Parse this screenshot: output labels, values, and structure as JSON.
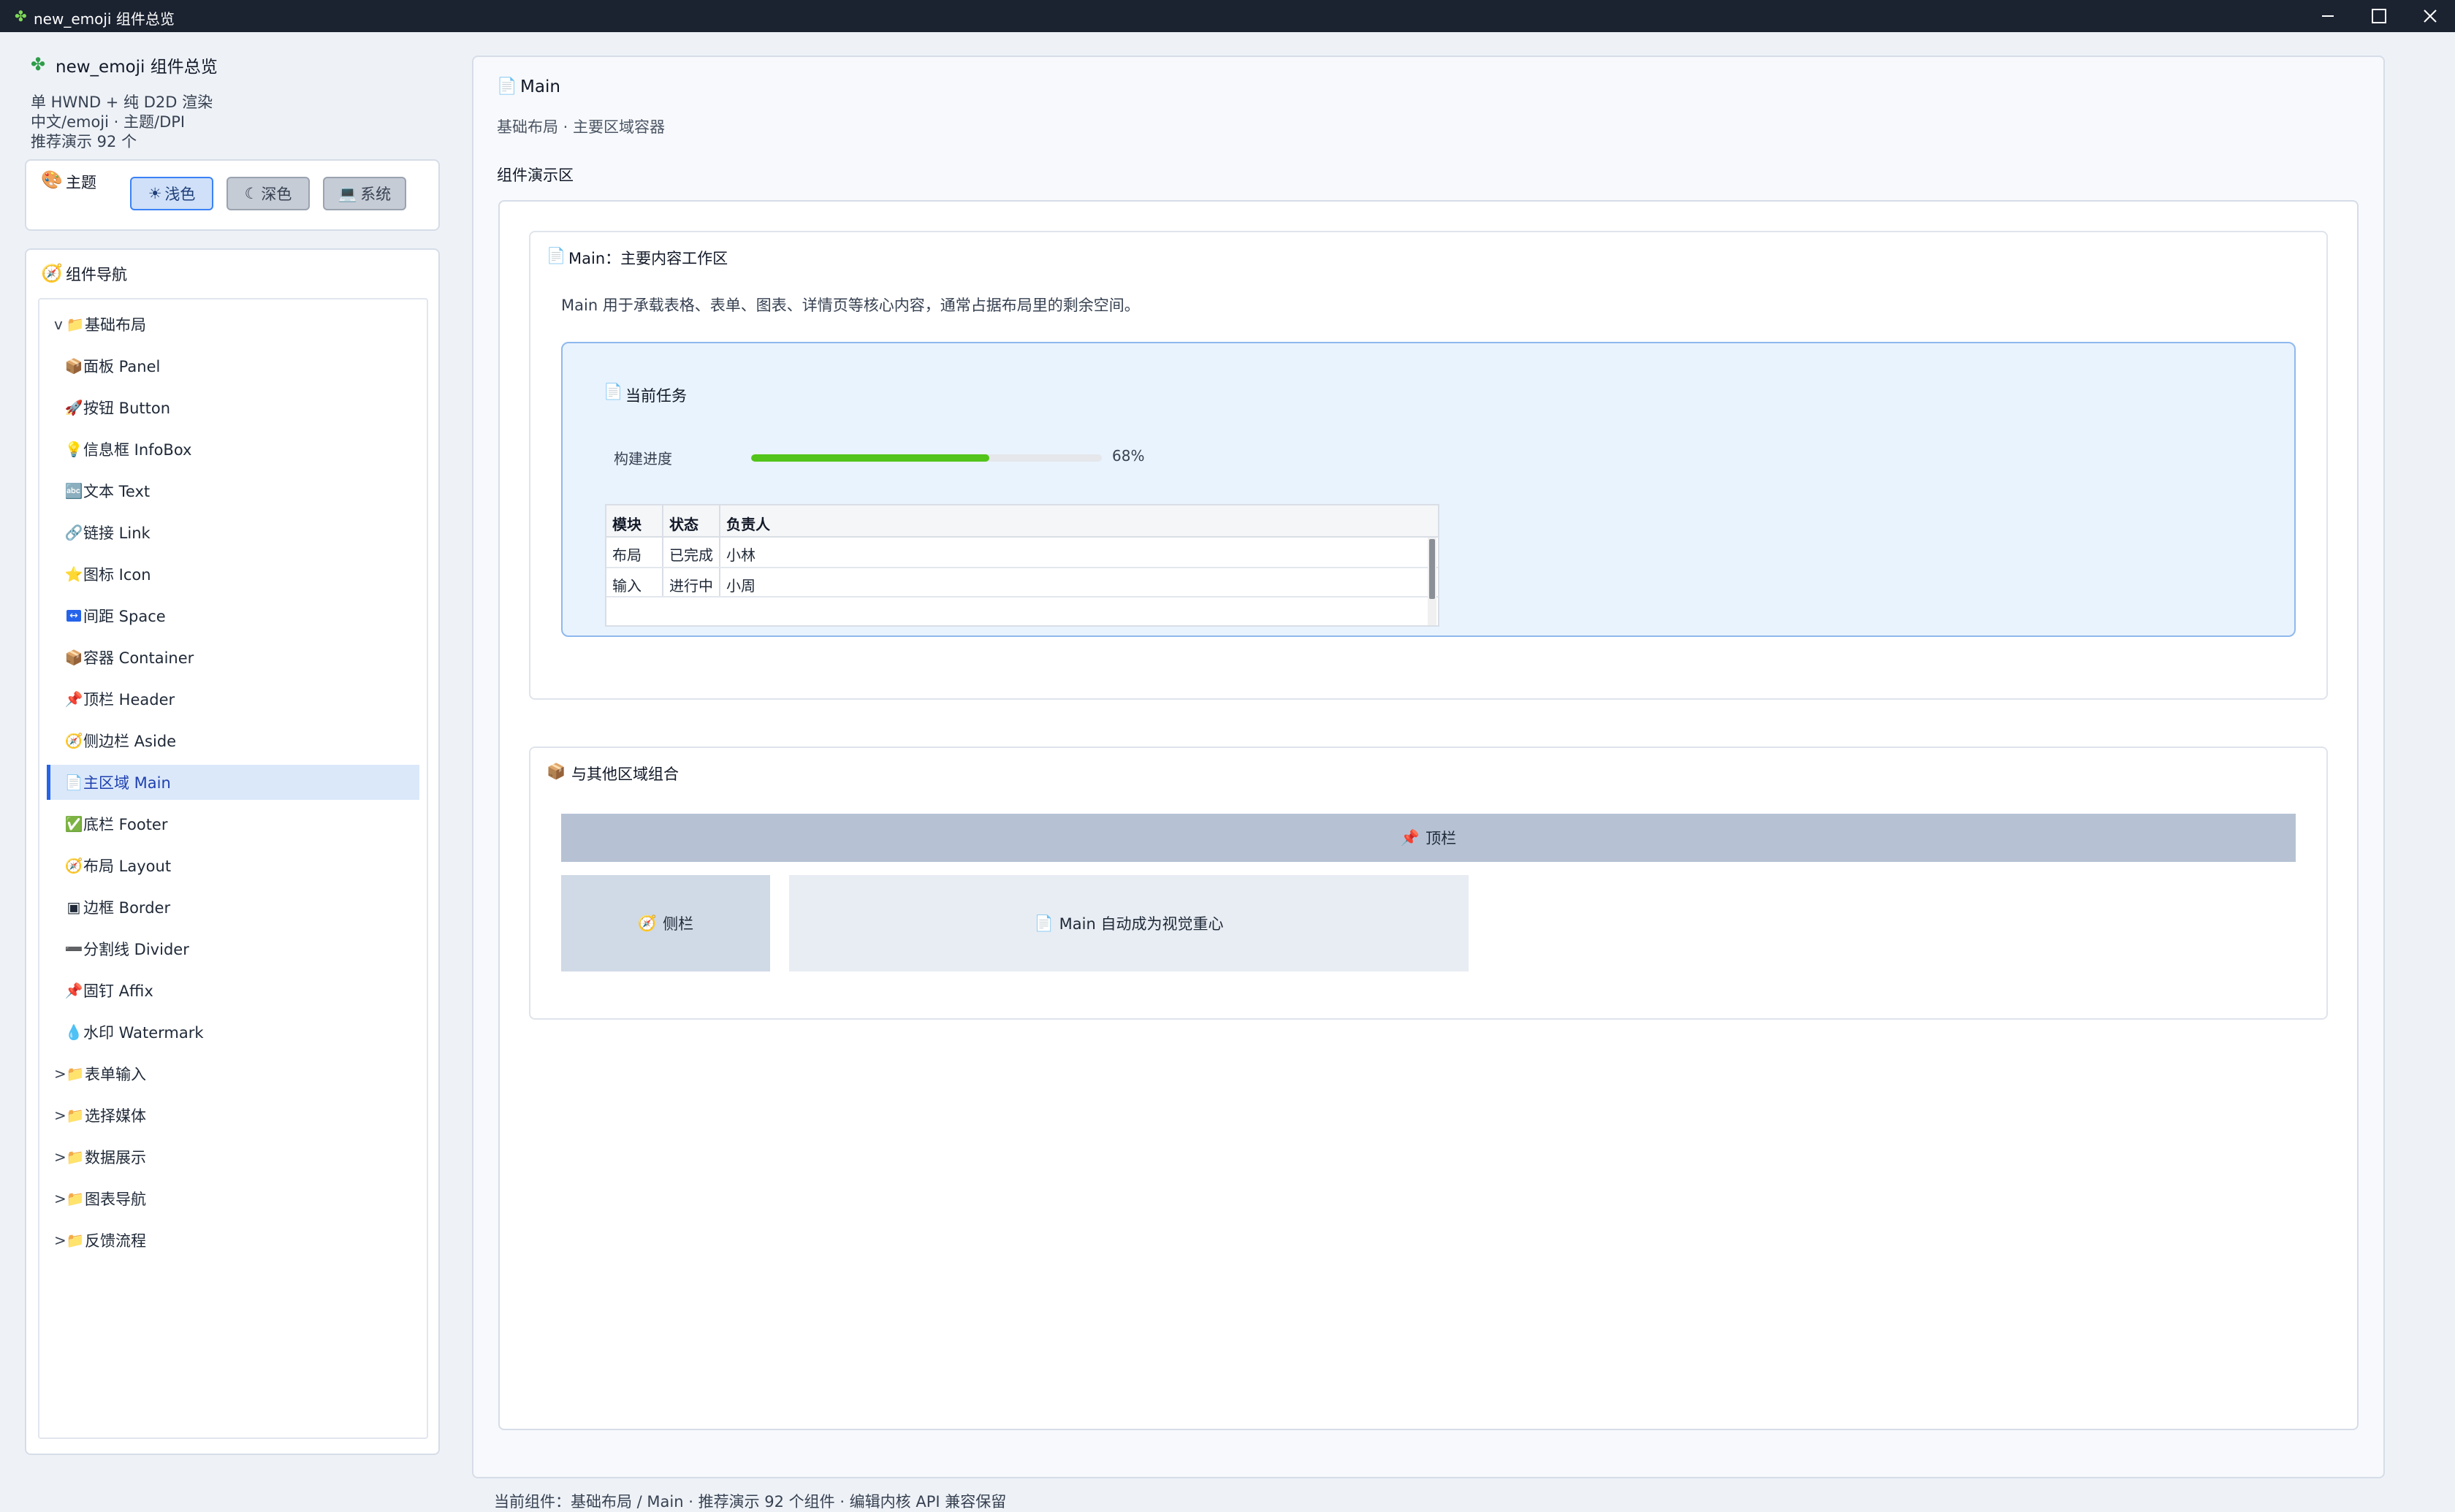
{
  "window": {
    "title": "new_emoji 组件总览"
  },
  "sidebar": {
    "app_title": "new_emoji 组件总览",
    "sub_lines": [
      "单 HWND + 纯 D2D 渲染",
      "中文/emoji · 主题/DPI",
      "推荐演示 92 个"
    ],
    "theme": {
      "label": "主题",
      "buttons": [
        {
          "label": "浅色",
          "icon": "sun-icon",
          "active": true
        },
        {
          "label": "深色",
          "icon": "moon-icon",
          "active": false
        },
        {
          "label": "系统",
          "icon": "laptop-icon",
          "active": false
        }
      ]
    },
    "nav": {
      "label": "组件导航",
      "groups_expanded": {
        "arrow": "v",
        "label": "基础布局"
      },
      "children": [
        {
          "label": "面板 Panel",
          "icon": "📦"
        },
        {
          "label": "按钮 Button",
          "icon": "🚀"
        },
        {
          "label": "信息框 InfoBox",
          "icon": "💡"
        },
        {
          "label": "文本 Text",
          "icon": "🔤"
        },
        {
          "label": "链接 Link",
          "icon": "🔗"
        },
        {
          "label": "图标 Icon",
          "icon": "⭐"
        },
        {
          "label": "间距 Space",
          "icon": "↔"
        },
        {
          "label": "容器 Container",
          "icon": "📦"
        },
        {
          "label": "顶栏 Header",
          "icon": "📌"
        },
        {
          "label": "侧边栏 Aside",
          "icon": "🧭"
        },
        {
          "label": "主区域 Main",
          "icon": "📄",
          "selected": true
        },
        {
          "label": "底栏 Footer",
          "icon": "✅"
        },
        {
          "label": "布局 Layout",
          "icon": "🧭"
        },
        {
          "label": "边框 Border",
          "icon": "▣"
        },
        {
          "label": "分割线 Divider",
          "icon": "➖"
        },
        {
          "label": "固钉 Affix",
          "icon": "📌"
        },
        {
          "label": "水印 Watermark",
          "icon": "💧"
        }
      ],
      "collapsed_groups": [
        {
          "arrow": ">",
          "label": "表单输入"
        },
        {
          "arrow": ">",
          "label": "选择媒体"
        },
        {
          "arrow": ">",
          "label": "数据展示"
        },
        {
          "arrow": ">",
          "label": "图表导航"
        },
        {
          "arrow": ">",
          "label": "反馈流程"
        }
      ]
    }
  },
  "main": {
    "title": "Main",
    "subtitle": "基础布局 · 主要区域容器",
    "demo_label": "组件演示区",
    "section1": {
      "title": "Main：主要内容工作区",
      "description": "Main 用于承载表格、表单、图表、详情页等核心内容，通常占据布局里的剩余空间。",
      "task": {
        "title": "当前任务",
        "progress_label": "构建进度",
        "progress_value": 68,
        "progress_text": "68%",
        "table": {
          "headers": [
            "模块",
            "状态",
            "负责人"
          ],
          "rows": [
            [
              "布局",
              "已完成",
              "小林"
            ],
            [
              "输入",
              "进行中",
              "小周"
            ]
          ]
        }
      }
    },
    "section2": {
      "title": "与其他区域组合",
      "header_label": "顶栏",
      "aside_label": "侧栏",
      "main_label": "Main 自动成为视觉重心"
    }
  },
  "status_bar": "当前组件：基础布局 / Main · 推荐演示 92 个组件 · 编辑内核 API 兼容保留",
  "colors": {
    "accent": "#2563eb",
    "progress": "#52c41a",
    "titlebar": "#1b2230"
  }
}
